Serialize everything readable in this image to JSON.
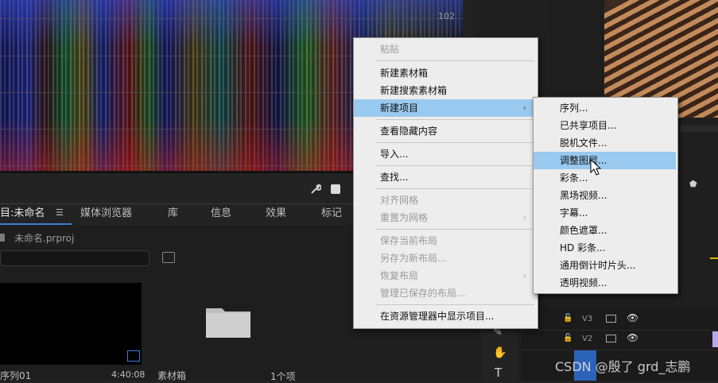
{
  "scope": {
    "top_value": "102"
  },
  "project_panel": {
    "tabs": [
      "目:未命名",
      "媒体浏览器",
      "库",
      "信息",
      "效果",
      "标记"
    ],
    "file_name": "未命名.prproj",
    "items": [
      {
        "name": "序列01",
        "duration": "4:40:08"
      },
      {
        "name": "素材箱",
        "count": "1个项"
      }
    ]
  },
  "timeline": {
    "tracks": [
      "V3",
      "V2"
    ]
  },
  "context_menu": {
    "items": [
      {
        "label": "粘贴",
        "disabled": true
      },
      {
        "label": "新建素材箱",
        "disabled": false
      },
      {
        "label": "新建搜索素材箱",
        "disabled": false
      },
      {
        "label": "新建项目",
        "disabled": false,
        "highlighted": true,
        "submenu": true
      },
      {
        "label": "查看隐藏内容",
        "disabled": false
      },
      {
        "label": "导入...",
        "disabled": false
      },
      {
        "label": "查找...",
        "disabled": false
      },
      {
        "label": "对齐网格",
        "disabled": true
      },
      {
        "label": "重置为网格",
        "disabled": true,
        "submenu": true
      },
      {
        "label": "保存当前布局",
        "disabled": true
      },
      {
        "label": "另存为新布局...",
        "disabled": true
      },
      {
        "label": "恢复布局",
        "disabled": true,
        "submenu": true
      },
      {
        "label": "管理已保存的布局...",
        "disabled": true
      },
      {
        "label": "在资源管理器中显示项目...",
        "disabled": false
      }
    ]
  },
  "submenu": {
    "items": [
      {
        "label": "序列..."
      },
      {
        "label": "已共享项目..."
      },
      {
        "label": "脱机文件..."
      },
      {
        "label": "调整图层...",
        "highlighted": true
      },
      {
        "label": "彩条..."
      },
      {
        "label": "黑场视频..."
      },
      {
        "label": "字幕..."
      },
      {
        "label": "颜色遮罩..."
      },
      {
        "label": "HD 彩条..."
      },
      {
        "label": "通用倒计时片头..."
      },
      {
        "label": "透明视频..."
      }
    ]
  },
  "watermark": "CSDN @殷了 grd_志鹏",
  "colors": {
    "menu_highlight": "#99c9ef",
    "accent_blue": "#3f7ad6"
  }
}
